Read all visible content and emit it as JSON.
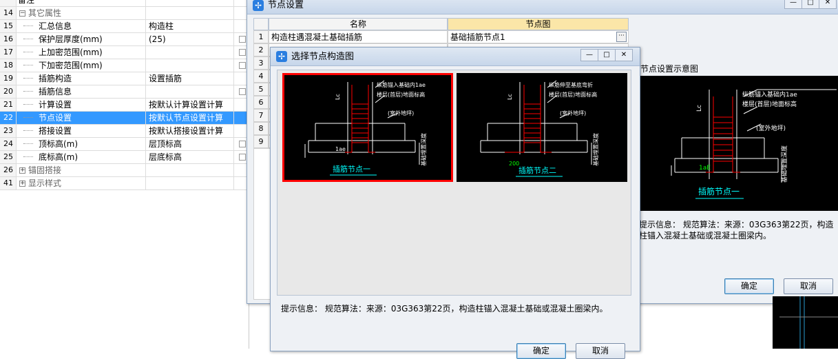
{
  "props": {
    "rows": [
      {
        "num": "",
        "name": "备注",
        "value": ""
      },
      {
        "num": "14",
        "name": "其它属性",
        "value": "",
        "group": true,
        "sign": "−"
      },
      {
        "num": "15",
        "name": "汇总信息",
        "value": "构造柱"
      },
      {
        "num": "16",
        "name": "保护层厚度(mm)",
        "value": "(25)"
      },
      {
        "num": "17",
        "name": "上加密范围(mm)",
        "value": ""
      },
      {
        "num": "18",
        "name": "下加密范围(mm)",
        "value": ""
      },
      {
        "num": "19",
        "name": "插筋构造",
        "value": "设置插筋"
      },
      {
        "num": "20",
        "name": "插筋信息",
        "value": ""
      },
      {
        "num": "21",
        "name": "计算设置",
        "value": "按默认计算设置计算"
      },
      {
        "num": "22",
        "name": "节点设置",
        "value": "按默认节点设置计算"
      },
      {
        "num": "23",
        "name": "搭接设置",
        "value": "按默认搭接设置计算"
      },
      {
        "num": "24",
        "name": "顶标高(m)",
        "value": "层顶标高"
      },
      {
        "num": "25",
        "name": "底标高(m)",
        "value": "层底标高"
      },
      {
        "num": "26",
        "name": "锚固搭接",
        "value": "",
        "group": true,
        "sign": "+"
      },
      {
        "num": "41",
        "name": "显示样式",
        "value": "",
        "group": true,
        "sign": "+"
      }
    ]
  },
  "node_window": {
    "title": "节点设置",
    "col_name": "名称",
    "col_diagram": "节点图",
    "rows": [
      {
        "num": "1",
        "name": "构造柱遇混凝土基础插筋",
        "diagram": "基础插筋节点1"
      },
      {
        "num": "2"
      },
      {
        "num": "3"
      },
      {
        "num": "4"
      },
      {
        "num": "5"
      },
      {
        "num": "6"
      },
      {
        "num": "7"
      },
      {
        "num": "8"
      },
      {
        "num": "9"
      }
    ],
    "preview_label": "节点设置示意图",
    "info": "提示信息：  规范算法：来源：03G363第22页，构造柱锚入混凝土基础或混凝土圈梁内。",
    "ok": "确定",
    "cancel": "取消",
    "preview": {
      "n1": "纵筋锚入基础内1ae",
      "n2": "楼层(首层)地面标高",
      "n3": "(室外地坪)",
      "lc": "Lc",
      "lae": "1aE",
      "depth": "基础埋置深度",
      "caption": "插筋节点一"
    }
  },
  "select_window": {
    "title": "选择节点构造图",
    "info": "提示信息：  规范算法：来源：03G363第22页，构造柱锚入混凝土基础或混凝土圈梁内。",
    "ok": "确定",
    "cancel": "取消",
    "diagram1": {
      "n1": "纵筋锚入基础内1ae",
      "n2": "楼层(首层)地面标高",
      "n3": "(室外地坪)",
      "lc": "Lc",
      "lae": "1ae",
      "depth": "基础埋置深度",
      "caption": "插筋节点一"
    },
    "diagram2": {
      "n1": "纵筋伸至基底弯折",
      "n2": "楼层(首层)地面标高",
      "n3": "(室外地坪)",
      "lc": "Lc",
      "dim": "200",
      "depth": "基础埋置深度",
      "caption": "插筋节点二"
    }
  },
  "colors": {
    "selection": "#3399ff",
    "diagram_bg": "#000000",
    "rebar": "#ff0000",
    "caption": "#00ffff",
    "selected_border": "#ff0000"
  }
}
